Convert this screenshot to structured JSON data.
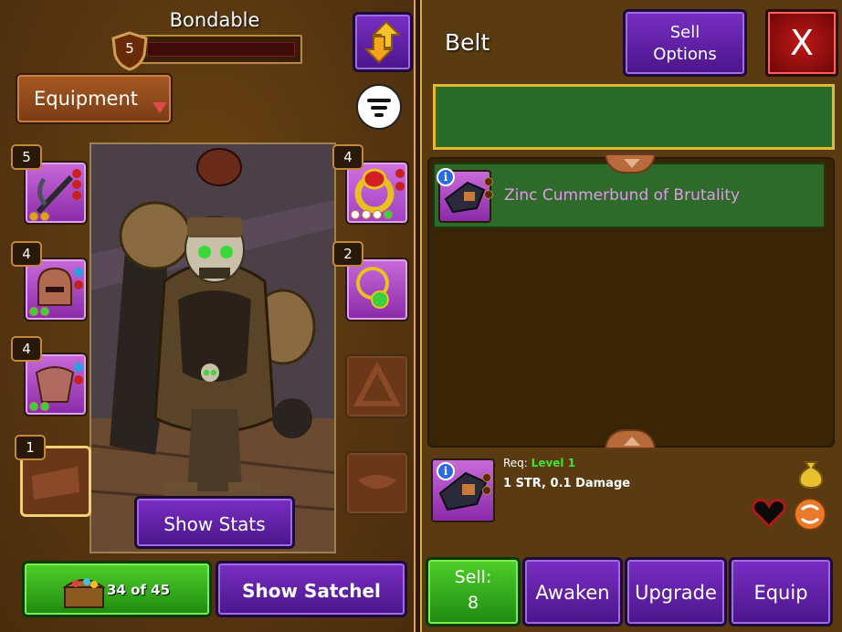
{
  "header": {
    "title": "Bondable",
    "bond_level": "5"
  },
  "left": {
    "dropdown_label": "Equipment",
    "slots": [
      {
        "level": "5"
      },
      {
        "level": "4"
      },
      {
        "level": "4"
      },
      {
        "level": "1"
      },
      {
        "level": "4"
      },
      {
        "level": "2"
      }
    ],
    "show_stats_label": "Show Stats",
    "satchel_count": "34 of 45",
    "show_satchel_label": "Show Satchel"
  },
  "right": {
    "category_title": "Belt",
    "sell_options_line1": "Sell",
    "sell_options_line2": "Options",
    "close_label": "X",
    "list_items": [
      {
        "name": "Zinc Cummerbund of Brutality"
      }
    ],
    "detail": {
      "req_label": "Req:",
      "req_level": "Level 1",
      "stats": "1 STR, 0.1 Damage"
    },
    "sell_label": "Sell:",
    "sell_value": "8",
    "awaken_label": "Awaken",
    "upgrade_label": "Upgrade",
    "equip_label": "Equip"
  },
  "colors": {
    "purple_button": "#7a2ec4",
    "green_button": "#4ed02a",
    "close_red": "#c01818",
    "item_name": "#e09ae8",
    "level_green": "#4ae02a"
  }
}
